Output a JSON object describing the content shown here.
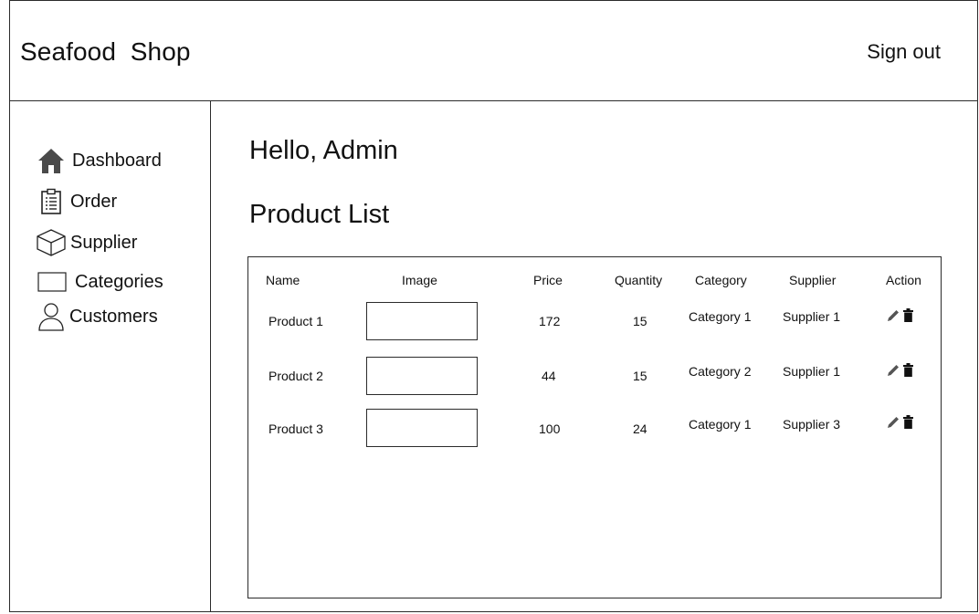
{
  "header": {
    "brand": "Seafood  Shop",
    "sign_out": "Sign out"
  },
  "sidebar": {
    "items": [
      {
        "label": "Dashboard",
        "icon": "home-icon"
      },
      {
        "label": "Order",
        "icon": "clipboard-list-icon"
      },
      {
        "label": "Supplier",
        "icon": "box-icon"
      },
      {
        "label": "Categories",
        "icon": "rectangle-icon"
      },
      {
        "label": "Customers",
        "icon": "user-icon"
      }
    ]
  },
  "main": {
    "greeting": "Hello, Admin",
    "title": "Product List",
    "table": {
      "columns": [
        "Name",
        "Image",
        "Price",
        "Quantity",
        "Category",
        "Supplier",
        "Action"
      ],
      "rows": [
        {
          "name": "Product 1",
          "price": "172",
          "quantity": "15",
          "category": "Category 1",
          "supplier": "Supplier 1"
        },
        {
          "name": "Product 2",
          "price": "44",
          "quantity": "15",
          "category": "Category 2",
          "supplier": "Supplier 1"
        },
        {
          "name": "Product 3",
          "price": "100",
          "quantity": "24",
          "category": "Category 1",
          "supplier": "Supplier 3"
        }
      ],
      "action_icons": [
        "pencil-icon",
        "trash-icon"
      ]
    }
  }
}
